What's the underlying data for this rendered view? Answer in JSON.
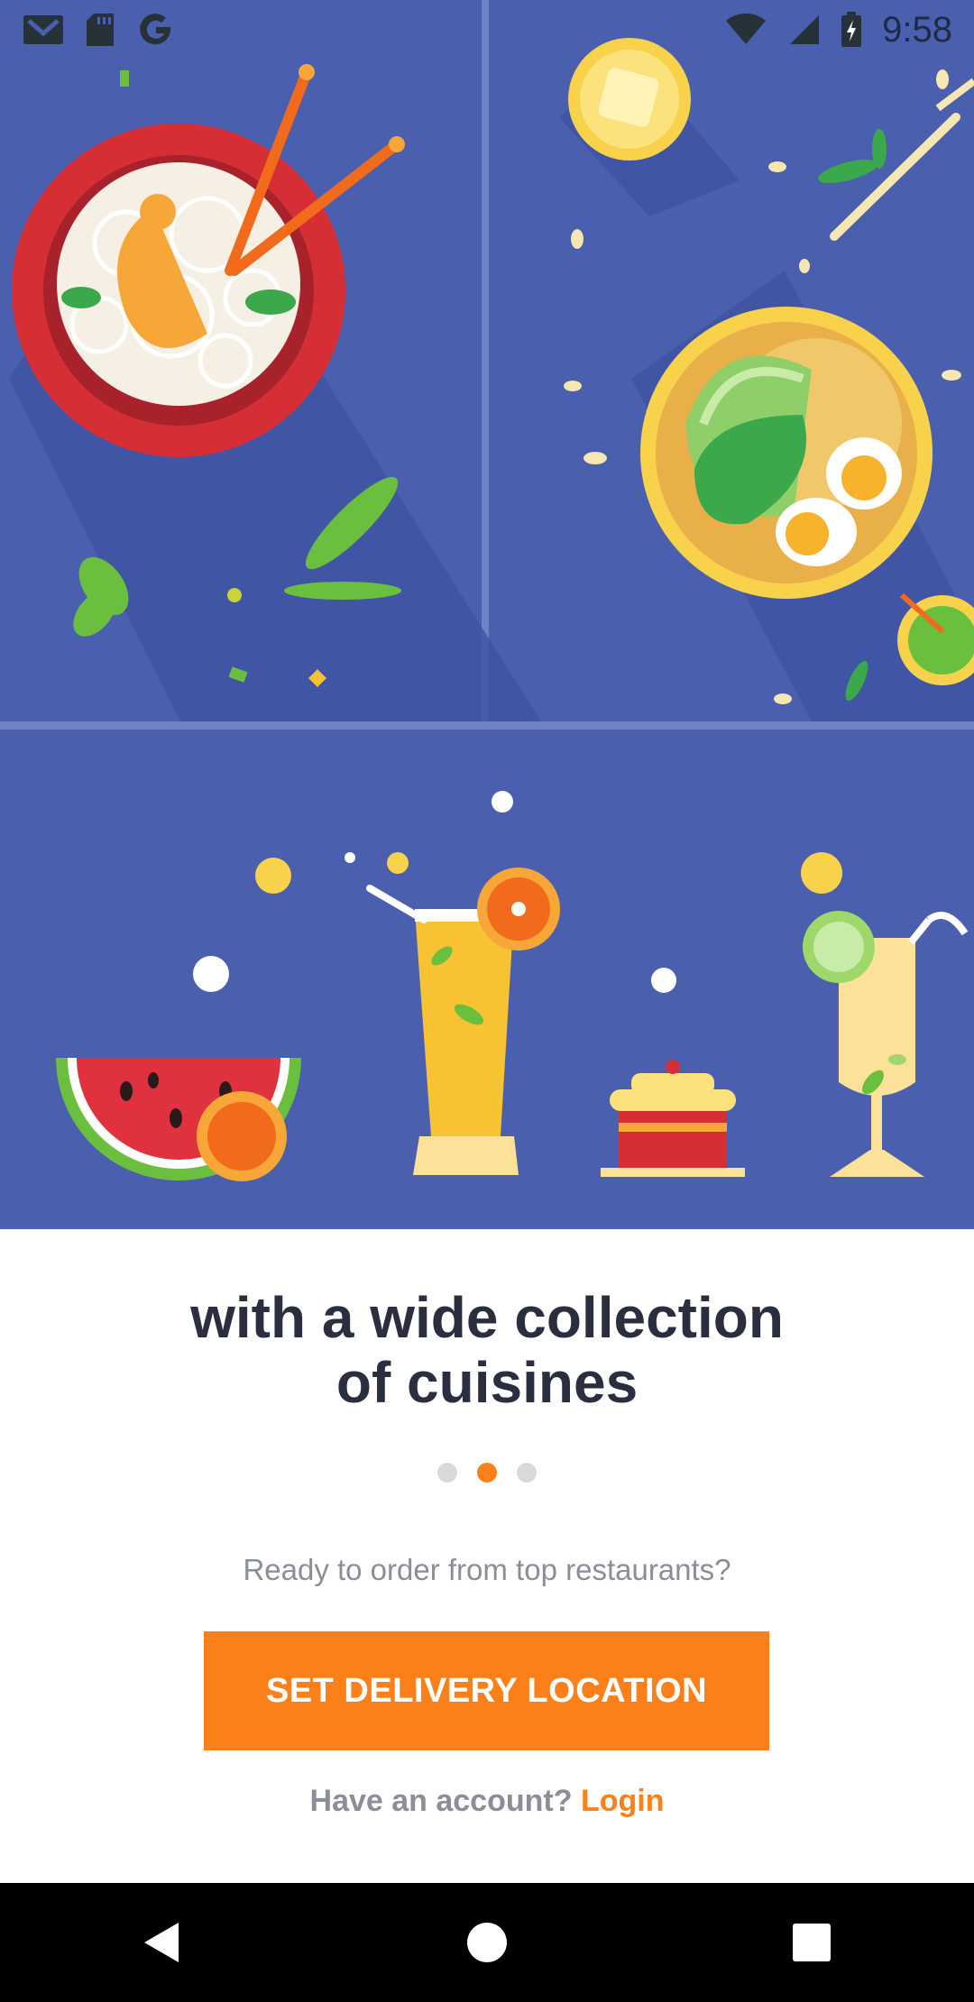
{
  "status_bar": {
    "time": "9:58",
    "left_icons": [
      "gmail-icon",
      "sd-card-icon",
      "google-icon"
    ],
    "right_icons": [
      "wifi-icon",
      "signal-icon",
      "battery-charging-icon"
    ]
  },
  "onboarding": {
    "headline_line1": "with a wide collection",
    "headline_line2": "of cuisines",
    "page_indicator": {
      "total": 3,
      "active": 2
    },
    "prompt": "Ready to order from top restaurants?",
    "cta_label": "SET DELIVERY LOCATION",
    "account_question": "Have an account?",
    "login_label": "Login"
  },
  "nav_bar": {
    "icons": [
      "back-icon",
      "home-icon",
      "recents-icon"
    ]
  },
  "colors": {
    "accent": "#fc8019",
    "hero_background": "#4a5fae",
    "headline": "#2a2e3e",
    "muted_text": "#8b8e99"
  }
}
